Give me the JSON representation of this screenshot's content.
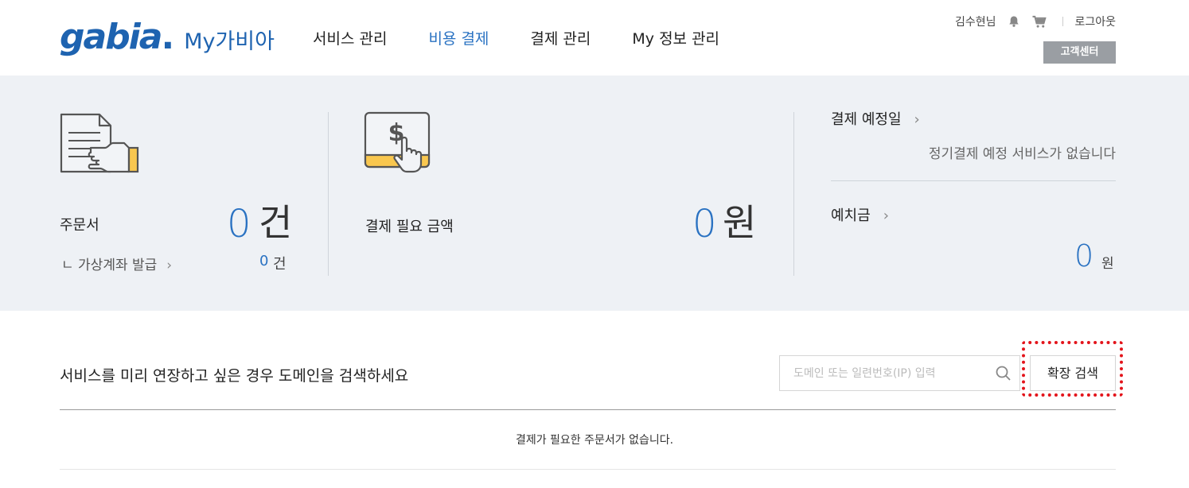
{
  "header": {
    "logo_text": "gabia",
    "logo_dot": ".",
    "logo_sub": "My가비아",
    "nav": [
      {
        "label": "서비스 관리",
        "active": false
      },
      {
        "label": "비용 결제",
        "active": true
      },
      {
        "label": "결제 관리",
        "active": false
      },
      {
        "label": "My 정보 관리",
        "active": false
      }
    ],
    "user_name": "김수현님",
    "bell_icon": "bell-icon",
    "cart_icon": "cart-icon",
    "logout": "로그아웃",
    "customer_center": "고객센터"
  },
  "summary": {
    "orders": {
      "label": "주문서",
      "count": "0",
      "unit": "건",
      "virtual_account_label": "ㄴ 가상계좌 발급",
      "virtual_account_count": "0",
      "virtual_account_unit": "건"
    },
    "payment_needed": {
      "label": "결제 필요 금액",
      "amount": "0",
      "unit": "원"
    },
    "schedule": {
      "title": "결제 예정일",
      "desc": "정기결제 예정 서비스가 없습니다"
    },
    "deposit": {
      "title": "예치금",
      "amount": "0",
      "unit": "원"
    }
  },
  "search": {
    "prompt": "서비스를 미리 연장하고 싶은 경우 도메인을 검색하세요",
    "placeholder": "도메인 또는 일련번호(IP) 입력",
    "extended_search": "확장 검색"
  },
  "table": {
    "empty_message": "결제가 필요한 주문서가 없습니다."
  },
  "colors": {
    "accent": "#2a72c2",
    "summary_bg": "#eef1f5",
    "highlight": "#e3141b",
    "illus_yellow": "#f9c74f"
  }
}
